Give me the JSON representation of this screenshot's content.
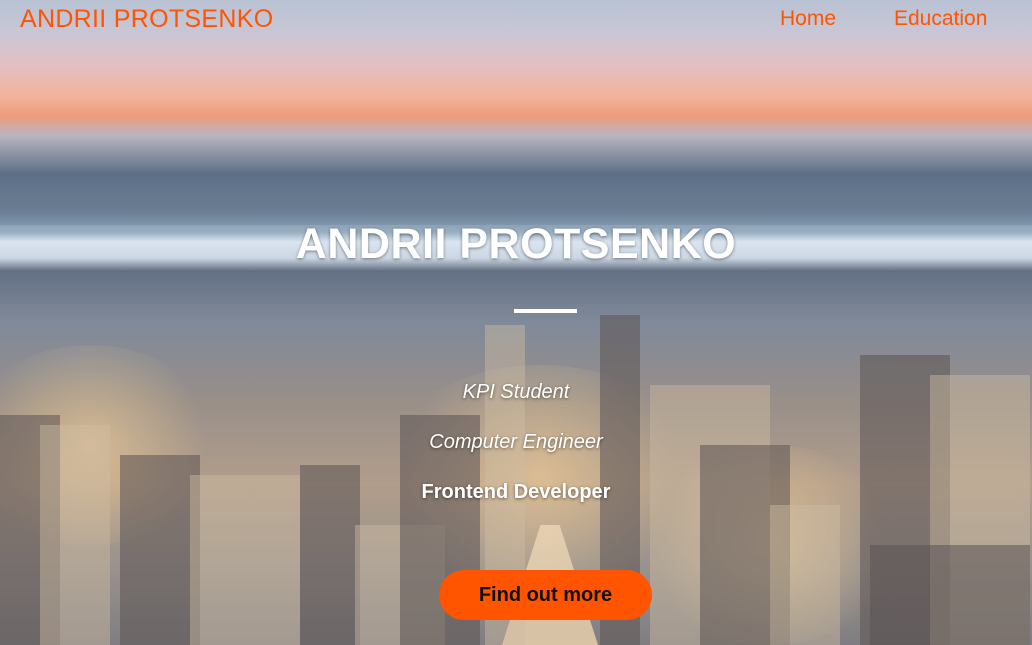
{
  "navbar": {
    "brand": "ANDRII PROTSENKO",
    "links": [
      "Home",
      "Education"
    ]
  },
  "hero": {
    "title": "ANDRII PROTSENKO",
    "roles": [
      "KPI Student",
      "Computer Engineer",
      "Frontend Developer"
    ],
    "cta_label": "Find out more"
  },
  "colors": {
    "accent": "#ff5500",
    "text_light": "#ffffff",
    "button_text": "#111111"
  }
}
